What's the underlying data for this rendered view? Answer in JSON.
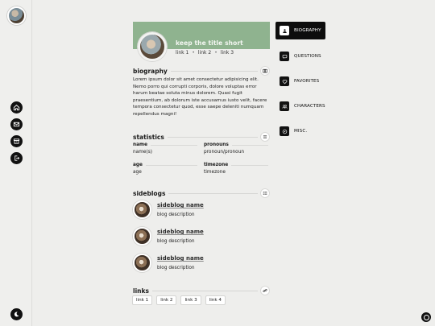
{
  "header": {
    "title": "keep the title short",
    "links": [
      "link 1",
      "link 2",
      "link 3"
    ]
  },
  "biography": {
    "heading": "biography",
    "text": "Lorem ipsum dolor sit amet consectetur adipisicing elit. Nemo porro qui corrupti corporis, dolore voluptas error harum beatae soluta minus dolorem. Quasi fugit praesentium, ab dolorum iste accusamus iusto velit, facere tempora consectetur quod, esse saepe deleniti numquam repellendus magni!"
  },
  "statistics": {
    "heading": "statistics",
    "items": [
      {
        "label": "name",
        "value": "name(s)"
      },
      {
        "label": "pronouns",
        "value": "pronoun/pronoun"
      },
      {
        "label": "age",
        "value": "age"
      },
      {
        "label": "timezone",
        "value": "timezone"
      }
    ]
  },
  "sideblogs": {
    "heading": "sideblogs",
    "items": [
      {
        "name": "sideblog name",
        "desc": "blog description"
      },
      {
        "name": "sideblog name",
        "desc": "blog description"
      },
      {
        "name": "sideblog name",
        "desc": "blog description"
      }
    ]
  },
  "links_section": {
    "heading": "links",
    "items": [
      "link 1",
      "link 2",
      "link 3",
      "link 4"
    ]
  },
  "nav": {
    "items": [
      "BIOGRAPHY",
      "QUESTIONS",
      "FAVORITES",
      "CHARACTERS",
      "MISC."
    ]
  },
  "colors": {
    "banner": "#8fb38f",
    "background": "#eeeeec",
    "accent": "#111111"
  }
}
